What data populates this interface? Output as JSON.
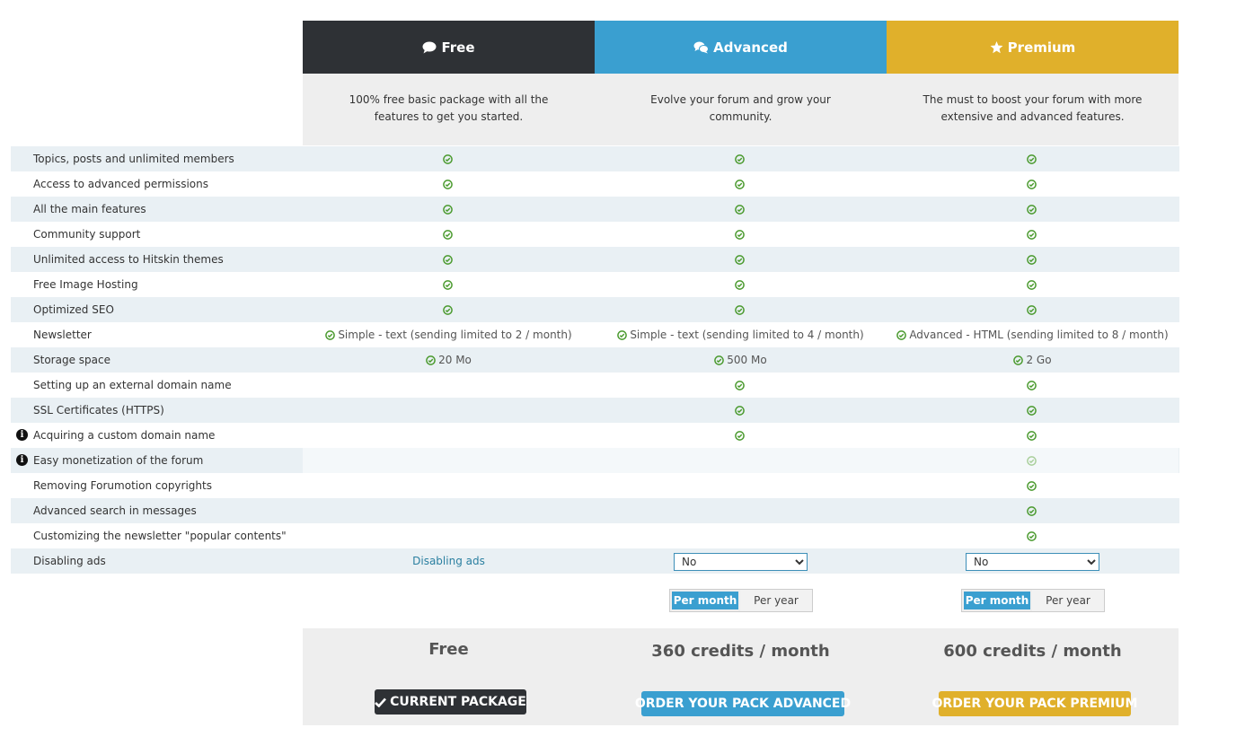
{
  "colors": {
    "free": "#2e3135",
    "advanced": "#3a9fd0",
    "premium": "#e0b02b",
    "check": "#4a9a2e"
  },
  "plans": [
    {
      "name": "Free",
      "icon": "speech-bubble-icon",
      "description": "100% free basic package with all the features to get you started."
    },
    {
      "name": "Advanced",
      "icon": "speech-bubbles-icon",
      "description": "Evolve your forum and grow your community."
    },
    {
      "name": "Premium",
      "icon": "star-icon",
      "description": "The must to boost your forum with more extensive and advanced features."
    }
  ],
  "features": [
    {
      "label": "Topics, posts and unlimited members"
    },
    {
      "label": "Access to advanced permissions"
    },
    {
      "label": "All the main features"
    },
    {
      "label": "Community support"
    },
    {
      "label": "Unlimited access to Hitskin themes"
    },
    {
      "label": "Free Image Hosting"
    },
    {
      "label": "Optimized SEO"
    },
    {
      "label": "Newsletter",
      "values": [
        "Simple - text (sending limited to 2 / month)",
        "Simple - text (sending limited to 4 / month)",
        "Advanced - HTML (sending limited to 8 / month)"
      ]
    },
    {
      "label": "Storage space",
      "values": [
        "20 Mo",
        "500 Mo",
        "2 Go"
      ]
    },
    {
      "label": "Setting up an external domain name"
    },
    {
      "label": "SSL Certificates (HTTPS)"
    },
    {
      "label": "Acquiring a custom domain name"
    },
    {
      "label": "Easy monetization of the forum"
    },
    {
      "label": "Removing Forumotion copyrights"
    },
    {
      "label": "Advanced search in messages"
    },
    {
      "label": "Customizing the newsletter \"popular contents\""
    },
    {
      "label": "Disabling ads"
    }
  ],
  "disabling_ads": {
    "free_link": "Disabling ads",
    "advanced_selected": "No",
    "premium_selected": "No"
  },
  "billing_toggle": {
    "per_month": "Per month",
    "per_year": "Per year"
  },
  "pricing": {
    "free": "Free",
    "advanced": "360 credits / month",
    "premium": "600 credits / month"
  },
  "buttons": {
    "current": "CURRENT PACKAGE",
    "order_advanced": "ORDER YOUR PACK ADVANCED",
    "order_premium": "ORDER YOUR PACK PREMIUM"
  }
}
